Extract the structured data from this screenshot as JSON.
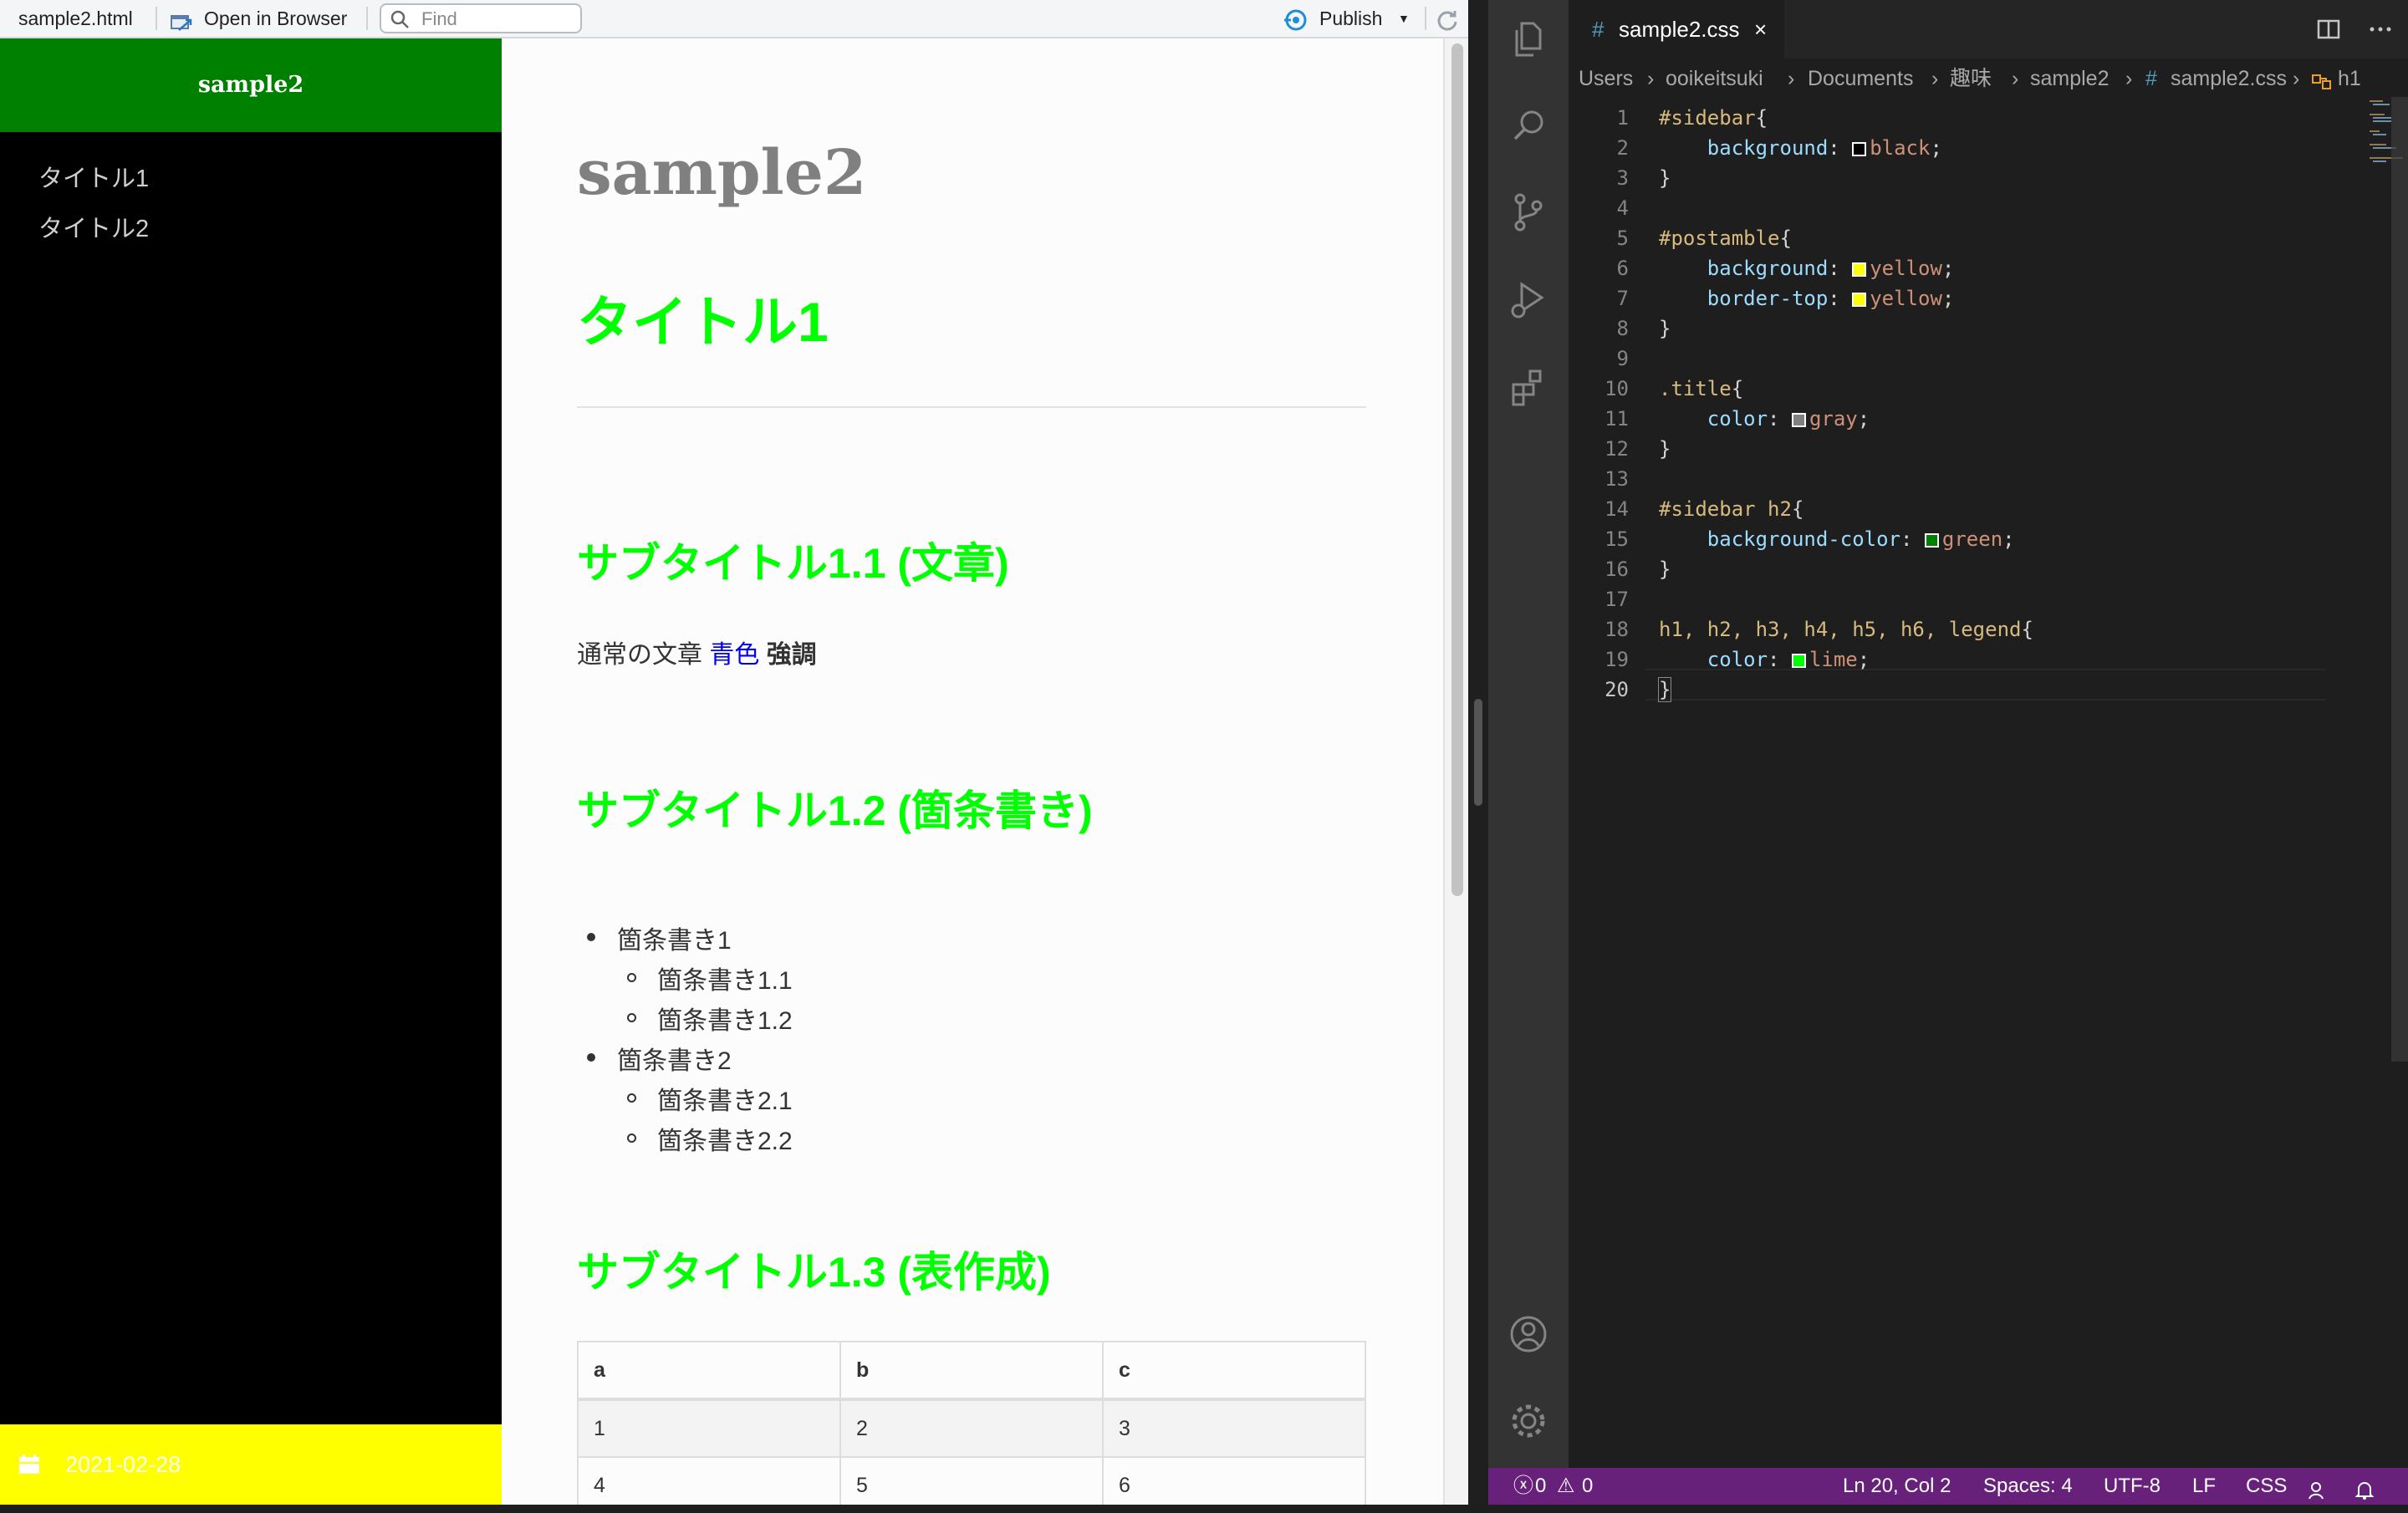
{
  "viewer": {
    "toolbar": {
      "filename": "sample2.html",
      "open_in_browser": "Open in Browser",
      "find_placeholder": "Find",
      "publish": "Publish"
    },
    "sidebar": {
      "title": "sample2",
      "toc": [
        "タイトル1",
        "タイトル2"
      ],
      "postamble_date": "2021-02-28"
    },
    "doc": {
      "title": "sample2",
      "h1": "タイトル1",
      "sub1": "サブタイトル1.1 (文章)",
      "para_normal": "通常の文章",
      "para_blue": "青色",
      "para_strong": "強調",
      "sub2": "サブタイトル1.2 (箇条書き)",
      "list": [
        {
          "text": "箇条書き1",
          "children": [
            "箇条書き1.1",
            "箇条書き1.2"
          ]
        },
        {
          "text": "箇条書き2",
          "children": [
            "箇条書き2.1",
            "箇条書き2.2"
          ]
        }
      ],
      "sub3": "サブタイトル1.3 (表作成)",
      "table": {
        "headers": [
          "a",
          "b",
          "c"
        ],
        "rows": [
          [
            "1",
            "2",
            "3"
          ],
          [
            "4",
            "5",
            "6"
          ]
        ]
      }
    }
  },
  "vscode": {
    "tab": {
      "icon": "#",
      "name": "sample2.css",
      "close": "×"
    },
    "breadcrumb": [
      "Users",
      "ooikeitsuki",
      "Documents",
      "趣味",
      "sample2",
      "sample2.css",
      "h1"
    ],
    "code_lines": [
      {
        "n": "1",
        "sel": "#sidebar",
        "rest": "{"
      },
      {
        "n": "2",
        "prop": "background",
        "swatch": "#000000",
        "val": "black"
      },
      {
        "n": "3",
        "rest": "}"
      },
      {
        "n": "4"
      },
      {
        "n": "5",
        "sel": "#postamble",
        "rest": "{"
      },
      {
        "n": "6",
        "prop": "background",
        "swatch": "#ffff00",
        "val": "yellow"
      },
      {
        "n": "7",
        "prop": "border-top",
        "swatch": "#ffff00",
        "val": "yellow"
      },
      {
        "n": "8",
        "rest": "}"
      },
      {
        "n": "9"
      },
      {
        "n": "10",
        "sel": ".title",
        "rest": "{"
      },
      {
        "n": "11",
        "prop": "color",
        "swatch": "#808080",
        "val": "gray"
      },
      {
        "n": "12",
        "rest": "}"
      },
      {
        "n": "13"
      },
      {
        "n": "14",
        "sel": "#sidebar h2",
        "rest": "{"
      },
      {
        "n": "15",
        "prop": "background-color",
        "swatch": "#008000",
        "val": "green"
      },
      {
        "n": "16",
        "rest": "}"
      },
      {
        "n": "17"
      },
      {
        "n": "18",
        "sel": "h1, h2, h3, h4, h5, h6, legend",
        "rest": "{"
      },
      {
        "n": "19",
        "prop": "color",
        "swatch": "#00ff00",
        "val": "lime"
      },
      {
        "n": "20",
        "rest": "}"
      }
    ],
    "status": {
      "errors": "0",
      "warnings": "0",
      "position": "Ln 20, Col 2",
      "spaces": "Spaces: 4",
      "encoding": "UTF-8",
      "eol": "LF",
      "language": "CSS"
    }
  }
}
